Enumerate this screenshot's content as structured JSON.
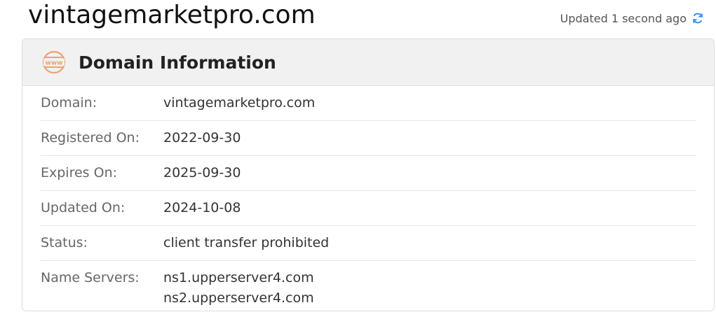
{
  "page": {
    "title": "vintagemarketpro.com"
  },
  "status": {
    "updated_text": "Updated 1 second ago",
    "refresh_icon": "refresh-icon"
  },
  "card": {
    "title": "Domain Information",
    "icon": "www-icon",
    "rows": [
      {
        "label": "Domain:",
        "value": "vintagemarketpro.com"
      },
      {
        "label": "Registered On:",
        "value": "2022-09-30"
      },
      {
        "label": "Expires On:",
        "value": "2025-09-30"
      },
      {
        "label": "Updated On:",
        "value": "2024-10-08"
      },
      {
        "label": "Status:",
        "value": "client transfer prohibited"
      },
      {
        "label": "Name Servers:",
        "values": [
          "ns1.upperserver4.com",
          "ns2.upperserver4.com"
        ]
      }
    ]
  },
  "colors": {
    "accent_orange": "#f0a070",
    "refresh_blue": "#3a8ee6"
  }
}
